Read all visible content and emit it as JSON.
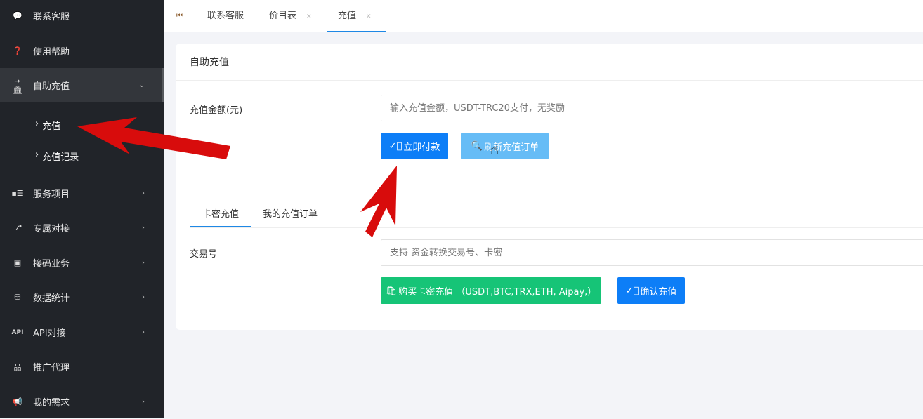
{
  "sidebar": {
    "items": [
      {
        "label": "联系客服",
        "icon": "chat-bubble-icon"
      },
      {
        "label": "使用帮助",
        "icon": "help-icon"
      },
      {
        "label": "自助充值",
        "icon": "bank-deposit-icon",
        "expanded": true
      },
      {
        "label": "服务项目",
        "icon": "id-card-icon"
      },
      {
        "label": "专属对接",
        "icon": "branch-icon"
      },
      {
        "label": "接码业务",
        "icon": "code-box-icon"
      },
      {
        "label": "数据统计",
        "icon": "database-clock-icon"
      },
      {
        "label": "API对接",
        "icon": "api-icon",
        "icon_text": "API"
      },
      {
        "label": "推广代理",
        "icon": "sitemap-icon"
      },
      {
        "label": "我的需求",
        "icon": "megaphone-icon"
      }
    ],
    "subitems": [
      {
        "label": "充值"
      },
      {
        "label": "充值记录"
      }
    ]
  },
  "tabs": [
    {
      "label": "联系客服"
    },
    {
      "label": "价目表"
    },
    {
      "label": "充值",
      "active": true
    }
  ],
  "card": {
    "title": "自助充值",
    "amount_label": "充值金额(元)",
    "amount_placeholder": "输入充值金额，USDT-TRC20支付，无奖励",
    "pay_button": "立即付款",
    "refresh_button": "刷新充值订单",
    "subtabs": [
      {
        "label": "卡密充值"
      },
      {
        "label": "我的充值订单"
      }
    ],
    "txn_label": "交易号",
    "txn_placeholder": "支持 资金转换交易号、卡密",
    "buy_button": "购买卡密充值 （USDT,BTC,TRX,ETH, Aipay,）",
    "confirm_button": "确认充值"
  },
  "colors": {
    "primary": "#0d7ef7",
    "primary_light": "#66bcf6",
    "success": "#16c477",
    "sidebar": "#212429",
    "annotation_arrow": "#d80c0c"
  }
}
